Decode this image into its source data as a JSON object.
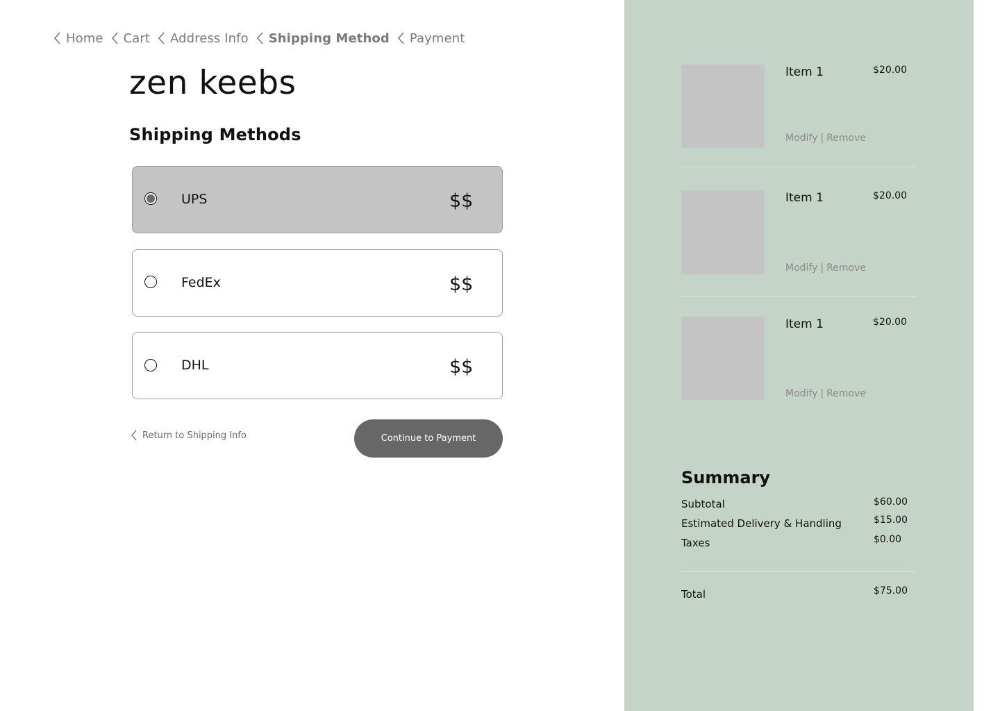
{
  "breadcrumb": [
    {
      "label": "Home",
      "active": false
    },
    {
      "label": "Cart",
      "active": false
    },
    {
      "label": "Address Info",
      "active": false
    },
    {
      "label": "Shipping Method",
      "active": true
    },
    {
      "label": "Payment",
      "active": false
    }
  ],
  "brand": "zen keebs",
  "section_title": "Shipping Methods",
  "shipping_options": [
    {
      "carrier": "UPS",
      "price": "$$",
      "selected": true
    },
    {
      "carrier": "FedEx",
      "price": "$$",
      "selected": false
    },
    {
      "carrier": "DHL",
      "price": "$$",
      "selected": false
    }
  ],
  "return_link": "Return to Shipping Info",
  "continue_button": "Continue to Payment",
  "cart_items": [
    {
      "name": "Item 1",
      "price": "$20.00",
      "modify": "Modify",
      "separator": "|",
      "remove": "Remove"
    },
    {
      "name": "Item 1",
      "price": "$20.00",
      "modify": "Modify",
      "separator": "|",
      "remove": "Remove"
    },
    {
      "name": "Item 1",
      "price": "$20.00",
      "modify": "Modify",
      "separator": "|",
      "remove": "Remove"
    }
  ],
  "summary": {
    "title": "Summary",
    "subtotal_label": "Subtotal",
    "subtotal_value": "$60.00",
    "delivery_label": "Estimated Delivery & Handling",
    "delivery_value": "$15.00",
    "taxes_label": "Taxes",
    "taxes_value": "$0.00",
    "total_label": "Total",
    "total_value": "$75.00"
  },
  "colors": {
    "panel_bg": "#c4d4c8",
    "selected_option_bg": "#c4c4c4",
    "button_bg": "#676767",
    "muted_text": "#7a7a7a"
  }
}
